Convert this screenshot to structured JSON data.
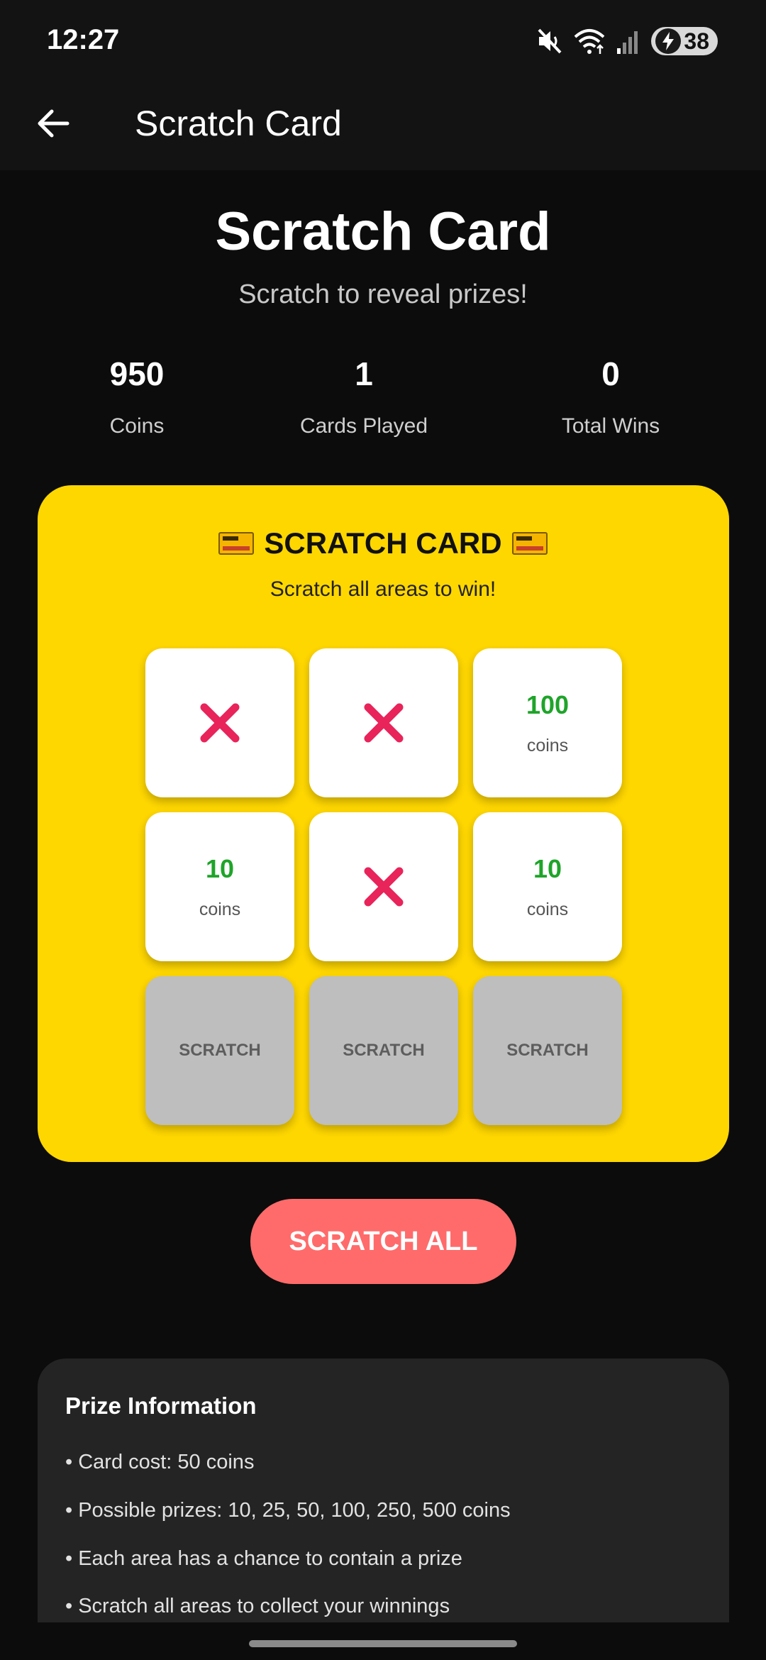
{
  "status_bar": {
    "time": "12:27",
    "battery": "38"
  },
  "app_bar": {
    "title": "Scratch Card"
  },
  "header": {
    "title": "Scratch Card",
    "subtitle": "Scratch to reveal prizes!"
  },
  "stats": [
    {
      "value": "950",
      "label": "Coins"
    },
    {
      "value": "1",
      "label": "Cards Played"
    },
    {
      "value": "0",
      "label": "Total Wins"
    }
  ],
  "card": {
    "title": "SCRATCH CARD",
    "subtitle": "Scratch all areas to win!",
    "tiles": [
      {
        "state": "lose",
        "icon": "red-x-icon"
      },
      {
        "state": "lose",
        "icon": "red-x-icon"
      },
      {
        "state": "prize",
        "amount": "100",
        "unit": "coins"
      },
      {
        "state": "prize",
        "amount": "10",
        "unit": "coins"
      },
      {
        "state": "lose",
        "icon": "red-x-icon"
      },
      {
        "state": "prize",
        "amount": "10",
        "unit": "coins"
      },
      {
        "state": "hidden",
        "label": "SCRATCH"
      },
      {
        "state": "hidden",
        "label": "SCRATCH"
      },
      {
        "state": "hidden",
        "label": "SCRATCH"
      }
    ]
  },
  "actions": {
    "scratch_all": "SCRATCH ALL"
  },
  "prize_info": {
    "title": "Prize Information",
    "lines": [
      "• Card cost: 50 coins",
      "• Possible prizes: 10, 25, 50, 100, 250, 500 coins",
      "• Each area has a chance to contain a prize",
      "• Scratch all areas to collect your winnings"
    ]
  },
  "colors": {
    "card": "#ffd700",
    "prize_text": "#1fa42a",
    "scratch_button": "#ff6b6b",
    "scratch_tile": "#bebebe"
  }
}
